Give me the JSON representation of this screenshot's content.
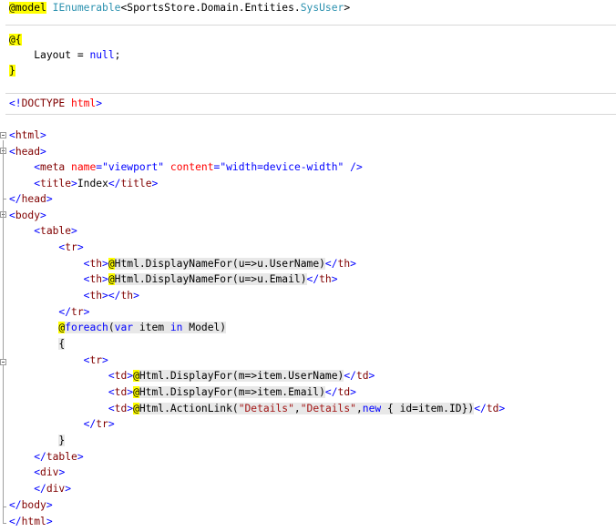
{
  "code_lines": {
    "l1": {
      "at": "@",
      "model": "model",
      "space": " ",
      "type": "IEnumerable",
      "generic": "<SportsStore.Domain.Entities.",
      "sysuser": "SysUser",
      "close": ">"
    },
    "l3": {
      "open": "@{"
    },
    "l4": {
      "indent": "    ",
      "layout": "Layout = ",
      "null": "null",
      "semi": ";"
    },
    "l5": {
      "close": "}"
    },
    "l7": {
      "lt": "<!",
      "doctype": "DOCTYPE",
      "space": " ",
      "html": "html",
      "gt": ">"
    },
    "l9": {
      "lt": "<",
      "name": "html",
      "gt": ">"
    },
    "l10": {
      "lt": "<",
      "name": "head",
      "gt": ">"
    },
    "l11": {
      "indent": "    ",
      "lt": "<",
      "name": "meta",
      "a1": " name",
      "eq1": "=",
      "v1": "\"viewport\"",
      "a2": " content",
      "eq2": "=",
      "v2": "\"width=device-width\"",
      "end": " />"
    },
    "l12": {
      "indent": "    ",
      "lt": "<",
      "name": "title",
      "gt": ">",
      "text": "Index",
      "lt2": "</",
      "name2": "title",
      "gt2": ">"
    },
    "l13": {
      "lt": "</",
      "name": "head",
      "gt": ">"
    },
    "l14": {
      "lt": "<",
      "name": "body",
      "gt": ">"
    },
    "l15": {
      "indent": "    ",
      "lt": "<",
      "name": "table",
      "gt": ">"
    },
    "l16": {
      "indent": "        ",
      "lt": "<",
      "name": "tr",
      "gt": ">"
    },
    "l17": {
      "indent": "            ",
      "lt": "<",
      "name": "th",
      "gt": ">",
      "at": "@",
      "code": "Html.DisplayNameFor(u=>u.UserName)",
      "lt2": "</",
      "name2": "th",
      "gt2": ">"
    },
    "l18": {
      "indent": "            ",
      "lt": "<",
      "name": "th",
      "gt": ">",
      "at": "@",
      "code": "Html.DisplayNameFor(u=>u.Email)",
      "lt2": "</",
      "name2": "th",
      "gt2": ">"
    },
    "l19": {
      "indent": "            ",
      "lt": "<",
      "name": "th",
      "gt": "></",
      "name2": "th",
      "gt2": ">"
    },
    "l20": {
      "indent": "        ",
      "lt": "</",
      "name": "tr",
      "gt": ">"
    },
    "l21": {
      "indent": "        ",
      "at": "@",
      "foreach": "foreach",
      "p1": "(",
      "var": "var",
      "item": " item ",
      "in": "in",
      "model": " Model)"
    },
    "l22": {
      "indent": "        ",
      "brace": "{"
    },
    "l23": {
      "indent": "            ",
      "lt": "<",
      "name": "tr",
      "gt": ">"
    },
    "l24": {
      "indent": "                ",
      "lt": "<",
      "name": "td",
      "gt": ">",
      "at": "@",
      "code": "Html.DisplayFor(m=>item.UserName)",
      "lt2": "</",
      "name2": "td",
      "gt2": ">"
    },
    "l25": {
      "indent": "                ",
      "lt": "<",
      "name": "td",
      "gt": ">",
      "at": "@",
      "code": "Html.DisplayFor(m=>item.Email)",
      "lt2": "</",
      "name2": "td",
      "gt2": ">"
    },
    "l26": {
      "indent": "                ",
      "lt": "<",
      "name": "td",
      "gt": ">",
      "at": "@",
      "c1": "Html.ActionLink(",
      "s1": "\"Details\"",
      "comma": ",",
      "s2": "\"Details\"",
      "comma2": ",",
      "new": "new",
      "c2": " { id=item.ID})",
      "lt2": "</",
      "name2": "td",
      "gt2": ">"
    },
    "l27": {
      "indent": "            ",
      "lt": "</",
      "name": "tr",
      "gt": ">"
    },
    "l28": {
      "indent": "        ",
      "brace": "}"
    },
    "l29": {
      "indent": "    ",
      "lt": "</",
      "name": "table",
      "gt": ">"
    },
    "l30": {
      "indent": "    ",
      "lt": "<",
      "name": "div",
      "gt": ">"
    },
    "l31": {
      "indent": "    ",
      "lt": "</",
      "name": "div",
      "gt": ">"
    },
    "l32": {
      "lt": "</",
      "name": "body",
      "gt": ">"
    },
    "l33": {
      "lt": "</",
      "name": "html",
      "gt": ">"
    }
  },
  "colors": {
    "keyword": "#0000ff",
    "tag_name": "#800000",
    "attribute": "#ff0000",
    "type_name": "#2b91af",
    "string": "#a31515",
    "razor_marker": "#ffff00",
    "code_block_bg": "#e8e8e8"
  }
}
